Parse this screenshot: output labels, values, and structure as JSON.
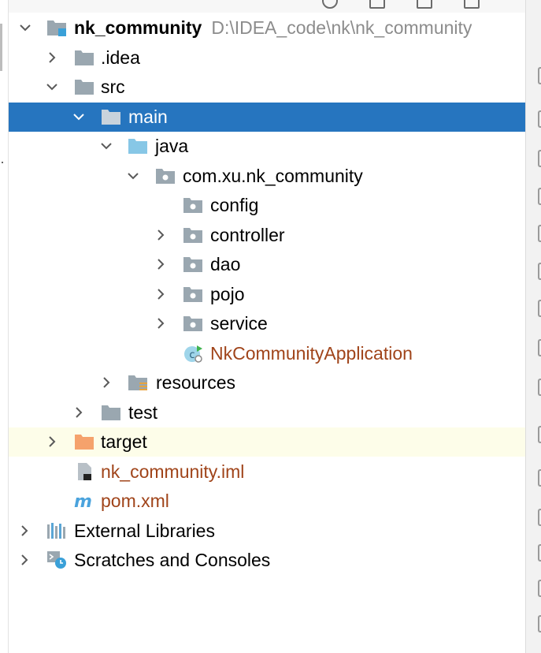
{
  "project_tree": {
    "items": [
      {
        "label": "nk_community",
        "path": "D:\\IDEA_code\\nk\\nk_community",
        "icon": "module-folder-icon",
        "expanded": true
      },
      {
        "label": ".idea",
        "icon": "folder-icon",
        "expanded": false
      },
      {
        "label": "src",
        "icon": "folder-icon",
        "expanded": true
      },
      {
        "label": "main",
        "icon": "folder-icon",
        "expanded": true,
        "selected": true
      },
      {
        "label": "java",
        "icon": "source-folder-icon",
        "expanded": true
      },
      {
        "label": "com.xu.nk_community",
        "icon": "package-icon",
        "expanded": true
      },
      {
        "label": "config",
        "icon": "package-icon"
      },
      {
        "label": "controller",
        "icon": "package-icon",
        "expanded": false
      },
      {
        "label": "dao",
        "icon": "package-icon",
        "expanded": false
      },
      {
        "label": "pojo",
        "icon": "package-icon",
        "expanded": false
      },
      {
        "label": "service",
        "icon": "package-icon",
        "expanded": false
      },
      {
        "label": "NkCommunityApplication",
        "icon": "spring-boot-class-icon"
      },
      {
        "label": "resources",
        "icon": "resources-folder-icon",
        "expanded": false
      },
      {
        "label": "test",
        "icon": "folder-icon",
        "expanded": false
      },
      {
        "label": "target",
        "icon": "excluded-folder-icon",
        "expanded": false,
        "highlighted": true
      },
      {
        "label": "nk_community.iml",
        "icon": "iml-file-icon"
      },
      {
        "label": "pom.xml",
        "icon": "maven-file-icon"
      },
      {
        "label": "External Libraries",
        "icon": "libraries-icon",
        "expanded": false
      },
      {
        "label": "Scratches and Consoles",
        "icon": "scratches-icon",
        "expanded": false
      }
    ]
  },
  "colors": {
    "selection": "#2675bf",
    "highlight": "#fdfde9",
    "modified_file": "#a0441a",
    "folder": "#9aa7b0",
    "source_folder": "#87c7e6",
    "excluded_folder": "#f5a26c"
  }
}
